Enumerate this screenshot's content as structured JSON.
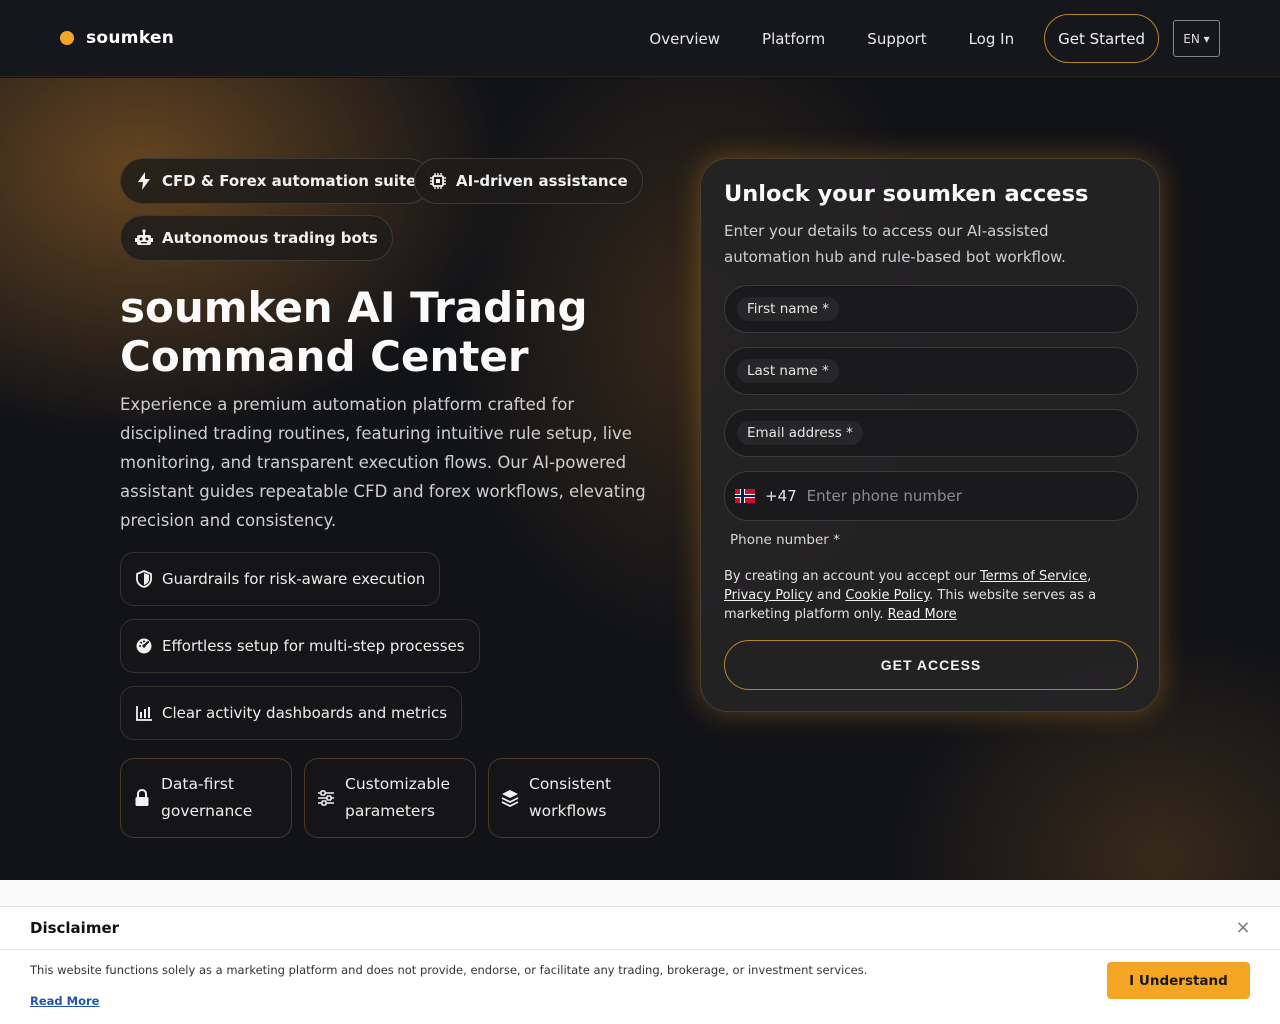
{
  "nav": {
    "logo": "soumken",
    "links": [
      "Overview",
      "Platform",
      "Support",
      "Log In"
    ],
    "cta": "Get Started",
    "lang": "EN ▾"
  },
  "hero": {
    "chips": [
      {
        "label": "CFD & Forex automation suite",
        "icon": "bolt-icon"
      },
      {
        "label": "AI-driven assistance",
        "icon": "chip-icon"
      },
      {
        "label": "Autonomous trading bots",
        "icon": "robot-icon"
      }
    ],
    "title": "soumken AI Trading Command Center",
    "description": "Experience a premium automation platform crafted for disciplined trading routines, featuring intuitive rule setup, live monitoring, and transparent execution flows. Our AI-powered assistant guides repeatable CFD and forex workflows, elevating precision and consistency.",
    "features": [
      {
        "label": "Guardrails for risk-aware execution",
        "icon": "shield-icon"
      },
      {
        "label": "Effortless setup for multi-step processes",
        "icon": "gauge-icon"
      },
      {
        "label": "Clear activity dashboards and metrics",
        "icon": "chart-icon"
      }
    ],
    "cards": [
      {
        "label": "Data-first governance",
        "icon": "lock-icon"
      },
      {
        "label": "Customizable parameters",
        "icon": "sliders-icon"
      },
      {
        "label": "Consistent workflows",
        "icon": "layers-icon"
      }
    ]
  },
  "form": {
    "title": "Unlock your soumken access",
    "subtitle": "Enter your details to access our AI-assisted automation hub and rule-based bot workflow.",
    "first_name": "First name *",
    "last_name": "Last name *",
    "email": "Email address *",
    "dial_code": "+47",
    "phone_placeholder": "Enter phone number",
    "phone_caption": "Phone number *",
    "terms_prefix": "By creating an account you accept our ",
    "terms_link": "Terms of Service",
    "terms_comma": ",",
    "privacy_link": "Privacy Policy",
    "terms_and": " and ",
    "cookie_link": "Cookie Policy",
    "terms_suffix": ". This website serves as a marketing platform only. ",
    "read_more": "Read More",
    "submit": "GET ACCESS"
  },
  "disclaimer": {
    "title": "Disclaimer",
    "close": "×",
    "text": "This website functions solely as a marketing platform and does not provide, endorse, or facilitate any trading, brokerage, or investment services.",
    "read_more": "Read More",
    "button": "I Understand"
  },
  "colors": {
    "accent": "#f5a524",
    "background": "#121317",
    "card": "#242324"
  }
}
